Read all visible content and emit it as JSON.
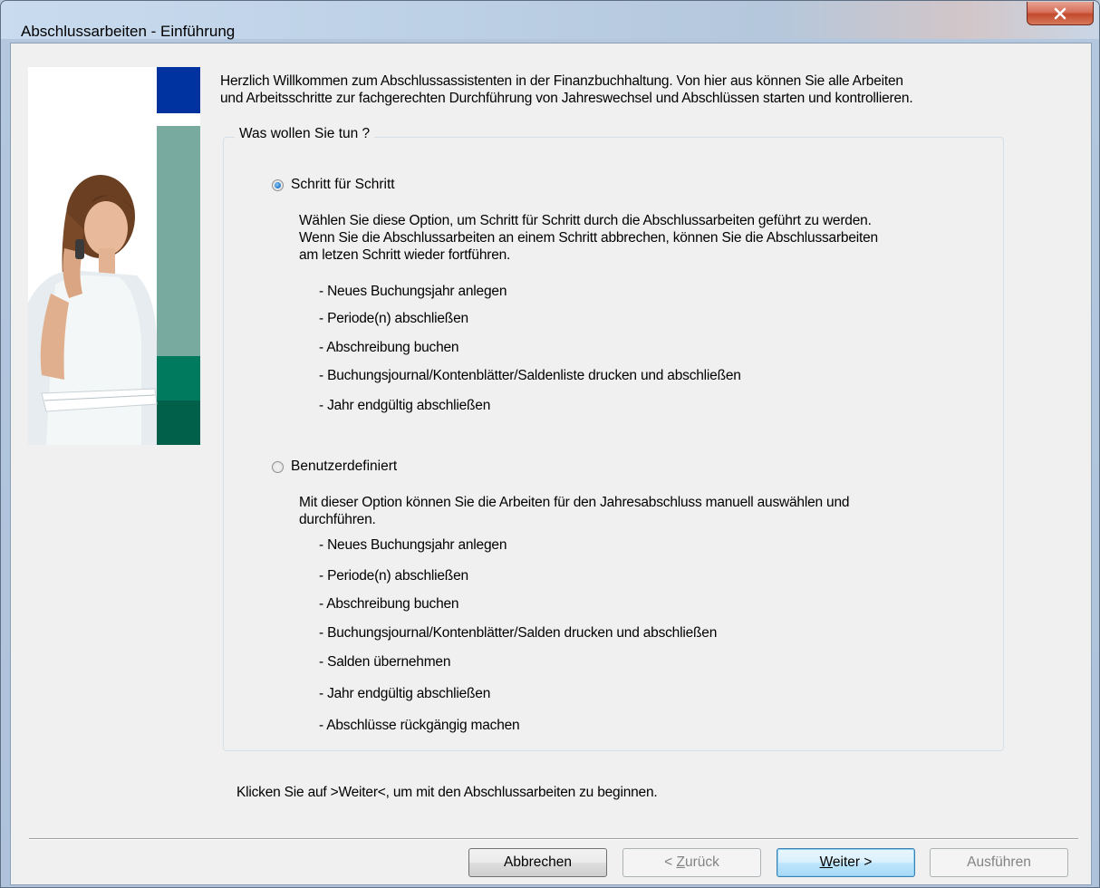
{
  "window": {
    "title": "Abschlussarbeiten - Einführung",
    "close_label": "x"
  },
  "intro": {
    "line1": "Herzlich Willkommen zum Abschlussassistenten in der Finanzbuchhaltung. Von hier aus können Sie alle Arbeiten",
    "line2": "und Arbeitsschritte zur fachgerechten Durchführung von Jahreswechsel und Abschlüssen starten und kontrollieren."
  },
  "group": {
    "legend": "Was wollen Sie tun ?"
  },
  "options": {
    "step_by_step": {
      "label": "Schritt für Schritt",
      "selected": true,
      "desc1": "Wählen Sie diese Option, um Schritt für Schritt durch die Abschlussarbeiten geführt zu werden.",
      "desc2": "Wenn Sie die Abschlussarbeiten an einem Schritt abbrechen, können Sie die Abschlussarbeiten",
      "desc3": "am letzen Schritt wieder fortführen.",
      "items": [
        "- Neues Buchungsjahr anlegen",
        "- Periode(n) abschließen",
        "- Abschreibung buchen",
        "- Buchungsjournal/Kontenblätter/Saldenliste drucken und abschließen",
        "- Jahr endgültig abschließen"
      ]
    },
    "custom": {
      "label": "Benutzerdefiniert",
      "selected": false,
      "desc1": "Mit dieser Option können Sie die Arbeiten für den Jahresabschluss manuell auswählen und",
      "desc2": "durchführen.",
      "items": [
        "- Neues Buchungsjahr anlegen",
        "- Periode(n) abschließen",
        "- Abschreibung buchen",
        "- Buchungsjournal/Kontenblätter/Salden drucken und abschließen",
        "- Salden übernehmen",
        "- Jahr endgültig abschließen",
        "- Abschlüsse rückgängig machen"
      ]
    }
  },
  "footer": {
    "hint": "Klicken Sie auf >Weiter<, um mit den Abschlussarbeiten zu beginnen."
  },
  "buttons": {
    "cancel": "Abbrechen",
    "back_prefix": "< ",
    "back_mnemonic": "Z",
    "back_rest": "urück",
    "next_mnemonic": "W",
    "next_rest": "eiter >",
    "execute": "Ausführen"
  },
  "colors": {
    "accent_blue": "#0033a0",
    "teal_light": "#78aa9f",
    "teal_dark": "#007a5e",
    "dialog_bg": "#f0f0f0",
    "close_red": "#c24a2e"
  }
}
